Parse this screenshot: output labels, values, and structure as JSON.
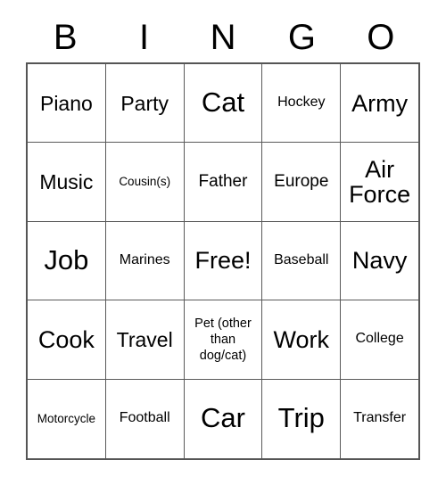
{
  "card": {
    "title": "BINGO",
    "header_letters": [
      "B",
      "I",
      "N",
      "G",
      "O"
    ],
    "free_space": "Free!",
    "colors": {
      "background": "#ffffff",
      "text": "#000000",
      "grid_line": "#5a5a5a",
      "outer_border": "#555555"
    },
    "grid_size": "5x5",
    "rows": [
      [
        {
          "label": "Piano",
          "size": "md"
        },
        {
          "label": "Party",
          "size": "md"
        },
        {
          "label": "Cat",
          "size": "xl"
        },
        {
          "label": "Hockey",
          "size": "xs"
        },
        {
          "label": "Army",
          "size": "lg"
        }
      ],
      [
        {
          "label": "Music",
          "size": "md"
        },
        {
          "label": "Cousin(s)",
          "size": "xxs"
        },
        {
          "label": "Father",
          "size": "sm"
        },
        {
          "label": "Europe",
          "size": "sm"
        },
        {
          "label": "Air Force",
          "size": "lg"
        }
      ],
      [
        {
          "label": "Job",
          "size": "xl"
        },
        {
          "label": "Marines",
          "size": "xs"
        },
        {
          "label": "Free!",
          "size": "lg"
        },
        {
          "label": "Baseball",
          "size": "xs"
        },
        {
          "label": "Navy",
          "size": "lg"
        }
      ],
      [
        {
          "label": "Cook",
          "size": "lg"
        },
        {
          "label": "Travel",
          "size": "md"
        },
        {
          "label": "Pet (other than dog/cat)",
          "size": "3l"
        },
        {
          "label": "Work",
          "size": "lg"
        },
        {
          "label": "College",
          "size": "xs"
        }
      ],
      [
        {
          "label": "Motorcycle",
          "size": "xxs"
        },
        {
          "label": "Football",
          "size": "xs"
        },
        {
          "label": "Car",
          "size": "xl"
        },
        {
          "label": "Trip",
          "size": "xl"
        },
        {
          "label": "Transfer",
          "size": "xs"
        }
      ]
    ]
  }
}
